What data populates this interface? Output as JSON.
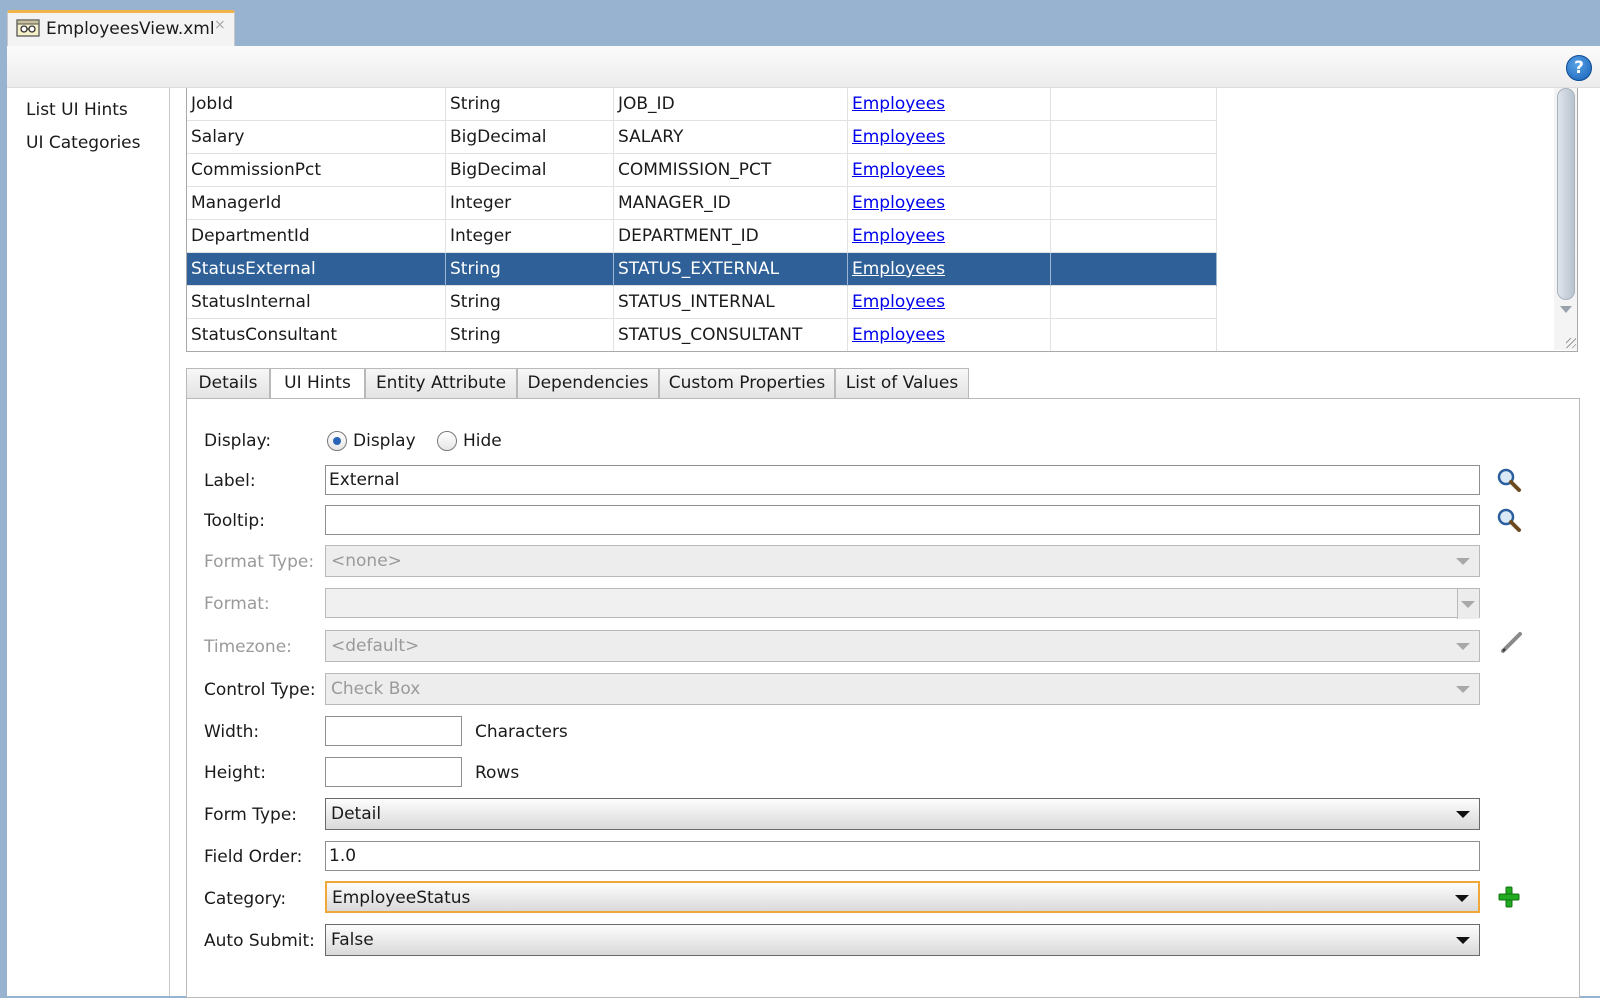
{
  "file_tab": {
    "title": "EmployeesView.xml",
    "close": "×"
  },
  "toolbar": {
    "help": "?"
  },
  "nav": {
    "items": [
      "List UI Hints",
      "UI Categories"
    ]
  },
  "attributes": {
    "rows": [
      {
        "name": "JobId",
        "type": "String",
        "column": "JOB_ID",
        "entity": "Employees",
        "selected": false
      },
      {
        "name": "Salary",
        "type": "BigDecimal",
        "column": "SALARY",
        "entity": "Employees",
        "selected": false
      },
      {
        "name": "CommissionPct",
        "type": "BigDecimal",
        "column": "COMMISSION_PCT",
        "entity": "Employees",
        "selected": false
      },
      {
        "name": "ManagerId",
        "type": "Integer",
        "column": "MANAGER_ID",
        "entity": "Employees",
        "selected": false
      },
      {
        "name": "DepartmentId",
        "type": "Integer",
        "column": "DEPARTMENT_ID",
        "entity": "Employees",
        "selected": false
      },
      {
        "name": "StatusExternal",
        "type": "String",
        "column": "STATUS_EXTERNAL",
        "entity": "Employees",
        "selected": true
      },
      {
        "name": "StatusInternal",
        "type": "String",
        "column": "STATUS_INTERNAL",
        "entity": "Employees",
        "selected": false
      },
      {
        "name": "StatusConsultant",
        "type": "String",
        "column": "STATUS_CONSULTANT",
        "entity": "Employees",
        "selected": false
      }
    ]
  },
  "tabs": {
    "details": "Details",
    "ui_hints": "UI Hints",
    "entity_attribute": "Entity Attribute",
    "dependencies": "Dependencies",
    "custom_properties": "Custom Properties",
    "list_of_values": "List of Values",
    "active": "UI Hints"
  },
  "form": {
    "display": {
      "label": "Display:",
      "option_display": "Display",
      "option_hide": "Hide",
      "selected": "Display"
    },
    "label": {
      "label": "Label:",
      "value": "External"
    },
    "tooltip": {
      "label": "Tooltip:",
      "value": ""
    },
    "format_type": {
      "label": "Format Type:",
      "value": "<none>"
    },
    "format": {
      "label": "Format:",
      "value": ""
    },
    "timezone": {
      "label": "Timezone:",
      "value": "<default>"
    },
    "control_type": {
      "label": "Control Type:",
      "value": "Check Box"
    },
    "width": {
      "label": "Width:",
      "value": "",
      "unit": "Characters"
    },
    "height": {
      "label": "Height:",
      "value": "",
      "unit": "Rows"
    },
    "form_type": {
      "label": "Form Type:",
      "value": "Detail"
    },
    "field_order": {
      "label": "Field Order:",
      "value": "1.0"
    },
    "category": {
      "label": "Category:",
      "value": "EmployeeStatus"
    },
    "auto_submit": {
      "label": "Auto Submit:",
      "value": "False"
    }
  },
  "colors": {
    "selection": "#2f6198",
    "link": "#0000ee",
    "focus": "#f0a83a",
    "add": "#1faa1f",
    "tab_accent": "#f1b24a"
  },
  "icons": {
    "search": "magnifier-icon",
    "edit": "pencil-icon",
    "add": "plus-icon",
    "help": "help-icon"
  }
}
